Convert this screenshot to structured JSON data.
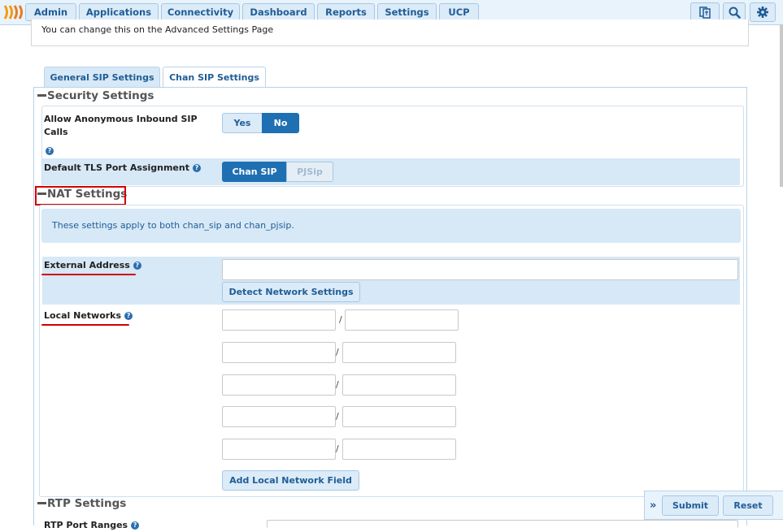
{
  "nav": {
    "items": [
      "Admin",
      "Applications",
      "Connectivity",
      "Dashboard",
      "Reports",
      "Settings",
      "UCP"
    ]
  },
  "notice": {
    "text": "You can change this on the Advanced Settings Page"
  },
  "tabs": [
    {
      "label": "General SIP Settings",
      "active": true
    },
    {
      "label": "Chan SIP Settings",
      "active": false
    }
  ],
  "security": {
    "title": "Security Settings",
    "anon_label": "Allow Anonymous Inbound SIP Calls",
    "anon_options": [
      "Yes",
      "No"
    ],
    "anon_selected": "No",
    "tls_label": "Default TLS Port Assignment",
    "tls_options": [
      "Chan SIP",
      "PJSip"
    ],
    "tls_selected": "Chan SIP"
  },
  "nat": {
    "title": "NAT Settings",
    "info": "These settings apply to both chan_sip and chan_pjsip.",
    "external_label": "External Address",
    "external_value": "",
    "detect_button": "Detect Network Settings",
    "local_label": "Local Networks",
    "slash": "/",
    "add_button": "Add Local Network Field"
  },
  "rtp": {
    "title": "RTP Settings",
    "port_label": "RTP Port Ranges"
  },
  "footer": {
    "submit": "Submit",
    "reset": "Reset",
    "expand": "»"
  },
  "colors": {
    "accent": "#1f6fb3",
    "highlight": "#d10000"
  }
}
